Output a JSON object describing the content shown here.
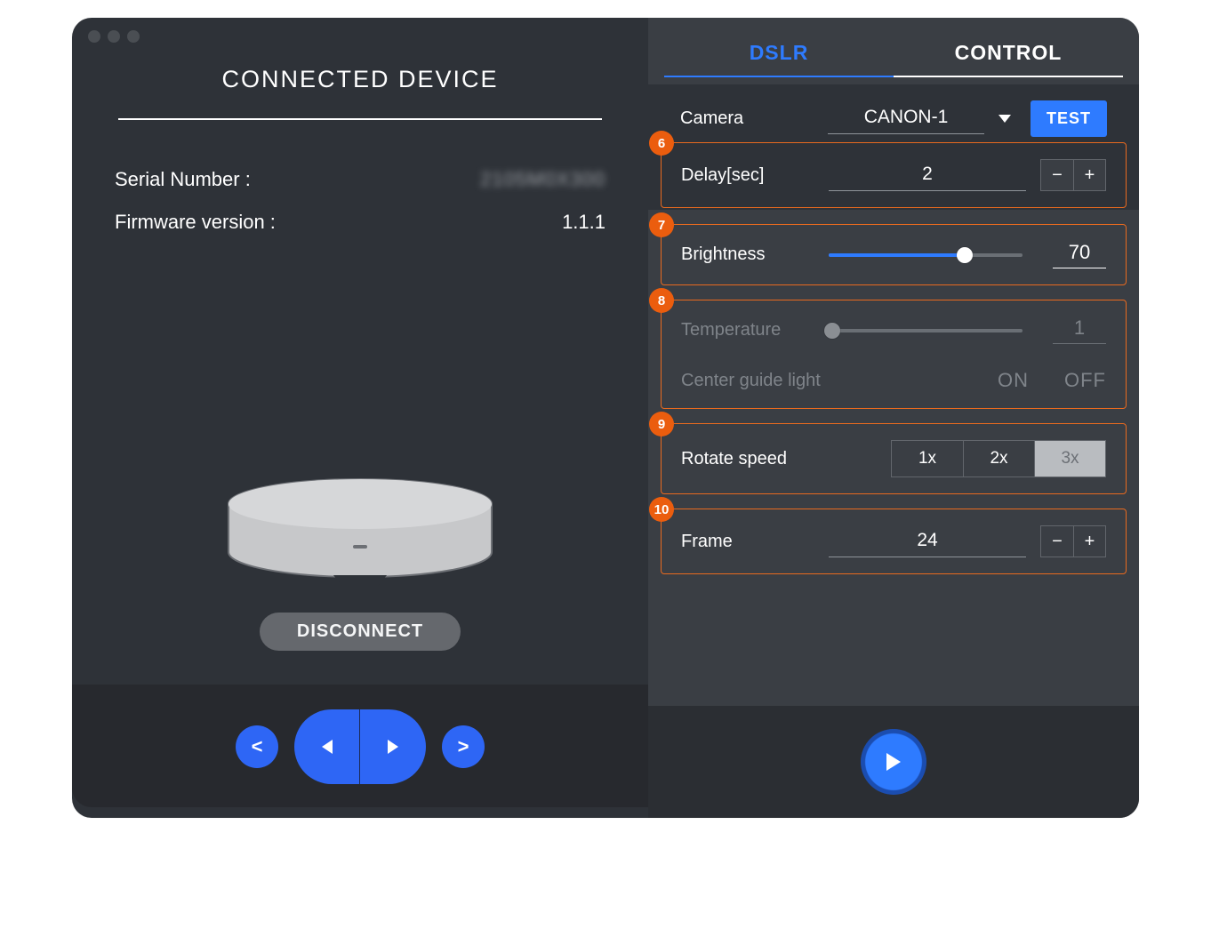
{
  "left": {
    "title": "CONNECTED DEVICE",
    "serial_label": "Serial Number :",
    "serial_value": "2105M0X300",
    "firmware_label": "Firmware version :",
    "firmware_value": "1.1.1",
    "disconnect_label": "DISCONNECT"
  },
  "nav": {
    "prev_small": "<",
    "next_small": ">"
  },
  "tabs": {
    "dslr": "DSLR",
    "control": "CONTROL",
    "active": "DSLR"
  },
  "camera": {
    "label": "Camera",
    "value": "CANON-1",
    "test_label": "TEST"
  },
  "sections": {
    "delay": {
      "badge": "6",
      "label": "Delay[sec]",
      "value": "2"
    },
    "brightness": {
      "badge": "7",
      "label": "Brightness",
      "value": "70",
      "percent": 70
    },
    "temperature": {
      "badge": "8",
      "label": "Temperature",
      "value": "1",
      "guide_label": "Center guide light",
      "on": "ON",
      "off": "OFF"
    },
    "rotate": {
      "badge": "9",
      "label": "Rotate speed",
      "options": [
        "1x",
        "2x",
        "3x"
      ],
      "selected": "3x"
    },
    "frame": {
      "badge": "10",
      "label": "Frame",
      "value": "24"
    }
  },
  "colors": {
    "accent_blue": "#2e7bff",
    "annotation_orange": "#e96a1f",
    "bg_dark": "#2e3238",
    "bg_mid": "#3a3e44"
  }
}
